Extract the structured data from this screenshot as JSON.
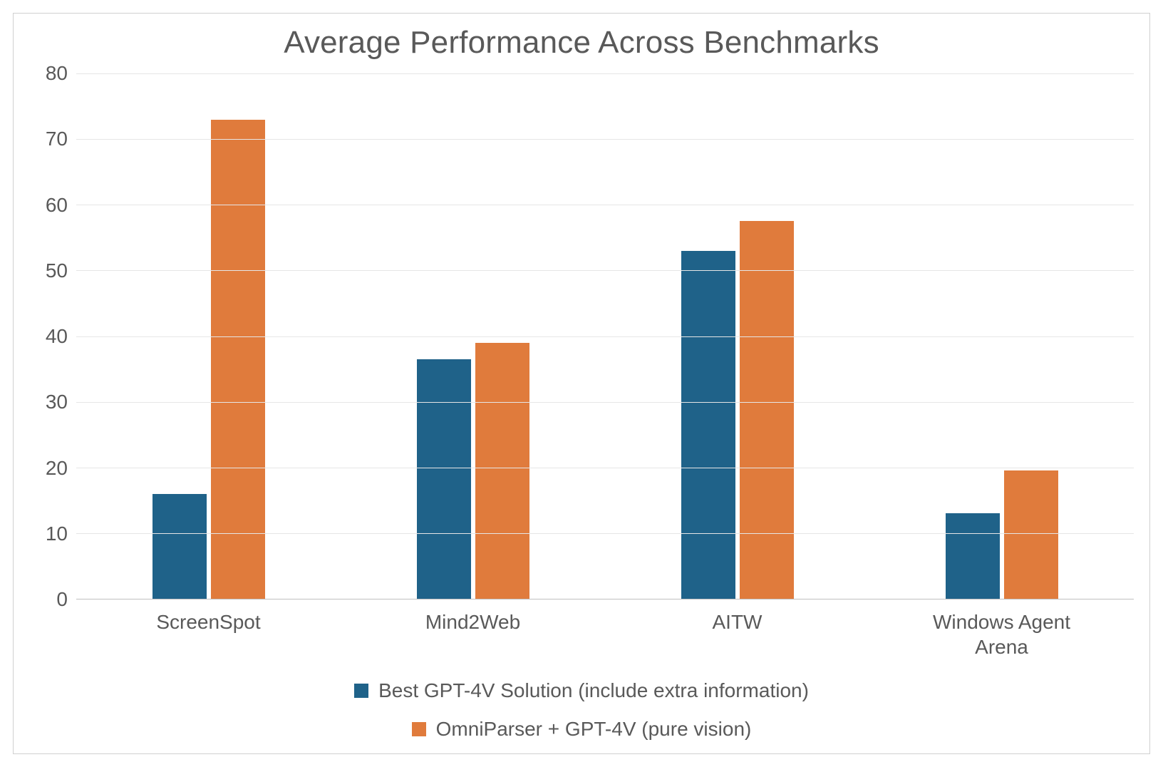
{
  "chart_data": {
    "type": "bar",
    "title": "Average Performance Across Benchmarks",
    "xlabel": "",
    "ylabel": "",
    "categories": [
      "ScreenSpot",
      "Mind2Web",
      "AITW",
      "Windows Agent\nArena"
    ],
    "series": [
      {
        "name": "Best GPT-4V Solution (include extra information)",
        "color": "#1f6289",
        "values": [
          16,
          36.5,
          53,
          13
        ]
      },
      {
        "name": "OmniParser + GPT-4V (pure vision)",
        "color": "#e07b3c",
        "values": [
          73,
          39,
          57.5,
          19.5
        ]
      }
    ],
    "ylim": [
      0,
      80
    ],
    "yticks": [
      0,
      10,
      20,
      30,
      40,
      50,
      60,
      70,
      80
    ],
    "grid": true,
    "legend_position": "bottom"
  }
}
